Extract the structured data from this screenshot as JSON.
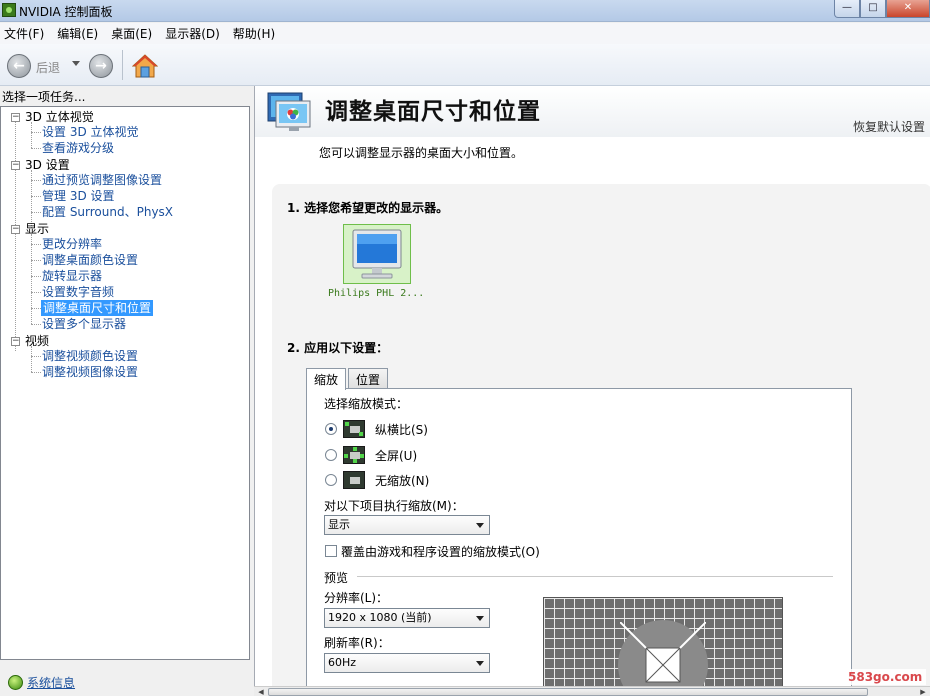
{
  "window": {
    "title": "NVIDIA 控制面板",
    "minimize": "—",
    "maximize": "□",
    "close": "✕"
  },
  "menu": [
    "文件(F)",
    "编辑(E)",
    "桌面(E)",
    "显示器(D)",
    "帮助(H)"
  ],
  "toolbar": {
    "back_label": "后退",
    "back_icon": "back-arrow-icon",
    "forward_icon": "forward-arrow-icon",
    "home_icon": "home-icon"
  },
  "left": {
    "header": "选择一项任务...",
    "tree": [
      {
        "type": "cat",
        "label": "3D 立体视觉"
      },
      {
        "type": "link",
        "label": "设置 3D 立体视觉"
      },
      {
        "type": "link",
        "label": "查看游戏分级"
      },
      {
        "type": "cat",
        "label": "3D 设置"
      },
      {
        "type": "link",
        "label": "通过预览调整图像设置"
      },
      {
        "type": "link",
        "label": "管理 3D 设置"
      },
      {
        "type": "link",
        "label": "配置 Surround、PhysX"
      },
      {
        "type": "cat",
        "label": "显示"
      },
      {
        "type": "link",
        "label": "更改分辨率"
      },
      {
        "type": "link",
        "label": "调整桌面颜色设置"
      },
      {
        "type": "link",
        "label": "旋转显示器"
      },
      {
        "type": "link",
        "label": "设置数字音频"
      },
      {
        "type": "link",
        "label": "调整桌面尺寸和位置",
        "selected": true
      },
      {
        "type": "link",
        "label": "设置多个显示器"
      },
      {
        "type": "cat",
        "label": "视频"
      },
      {
        "type": "link",
        "label": "调整视频颜色设置"
      },
      {
        "type": "link",
        "label": "调整视频图像设置"
      }
    ],
    "system_info": "系统信息"
  },
  "main": {
    "title": "调整桌面尺寸和位置",
    "restore_defaults": "恢复默认设置",
    "description": "您可以调整显示器的桌面大小和位置。",
    "step1": "1. 选择您希望更改的显示器。",
    "monitor_name": "Philips PHL 2...",
    "step2": "2. 应用以下设置：",
    "tabs": [
      "缩放",
      "位置"
    ],
    "active_tab": "缩放",
    "scaling_mode_label": "选择缩放模式：",
    "scaling_options": [
      {
        "label": "纵横比(S)",
        "checked": true
      },
      {
        "label": "全屏(U)",
        "checked": false
      },
      {
        "label": "无缩放(N)",
        "checked": false
      }
    ],
    "perform_scaling_on_label": "对以下项目执行缩放(M)：",
    "perform_scaling_on_value": "显示",
    "override_label": "覆盖由游戏和程序设置的缩放模式(O)",
    "override_checked": false,
    "preview_label": "预览",
    "resolution_label": "分辨率(L)：",
    "resolution_value": "1920 x 1080 (当前)",
    "refresh_label": "刷新率(R)：",
    "refresh_value": "60Hz"
  },
  "watermark": "583go.com",
  "colors": {
    "link": "#1a4f9c",
    "selected_bg": "#3399ff",
    "nvidia_green": "#76b900"
  }
}
